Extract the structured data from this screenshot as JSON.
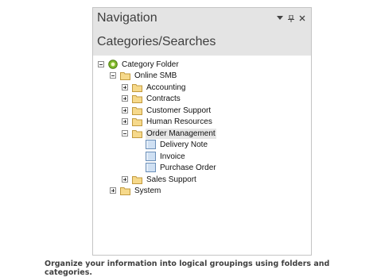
{
  "panel": {
    "title": "Navigation",
    "section_title": "Categories/Searches",
    "header_buttons": [
      "chevron-down-icon",
      "pin-icon",
      "close-icon"
    ],
    "colors": {
      "header_bg": "#e4e4e4",
      "folder_fill": "#f6d98b",
      "folder_stroke": "#c29a3e",
      "doc_fill": "#cfe0f3",
      "root_icon": "#7fba2b"
    }
  },
  "tree": {
    "root": {
      "label": "Category Folder",
      "expander": "minus",
      "icon": "category-root-icon"
    },
    "online_smb": {
      "label": "Online SMB",
      "expander": "minus",
      "icon": "folder-icon"
    },
    "children": [
      {
        "label": "Accounting",
        "expander": "plus",
        "icon": "folder-icon"
      },
      {
        "label": "Contracts",
        "expander": "plus",
        "icon": "folder-icon"
      },
      {
        "label": "Customer Support",
        "expander": "plus",
        "icon": "folder-icon"
      },
      {
        "label": "Human Resources",
        "expander": "plus",
        "icon": "folder-icon"
      },
      {
        "label": "Order Management",
        "expander": "minus",
        "icon": "folder-icon",
        "selected": true
      }
    ],
    "order_management_items": [
      {
        "label": "Delivery Note",
        "icon": "document-icon"
      },
      {
        "label": "Invoice",
        "icon": "document-icon"
      },
      {
        "label": "Purchase Order",
        "icon": "document-icon"
      }
    ],
    "sales_support": {
      "label": "Sales Support",
      "expander": "plus",
      "icon": "folder-icon"
    },
    "system": {
      "label": "System",
      "expander": "plus",
      "icon": "folder-icon"
    }
  },
  "caption": "Organize your information into logical groupings using folders and categories."
}
